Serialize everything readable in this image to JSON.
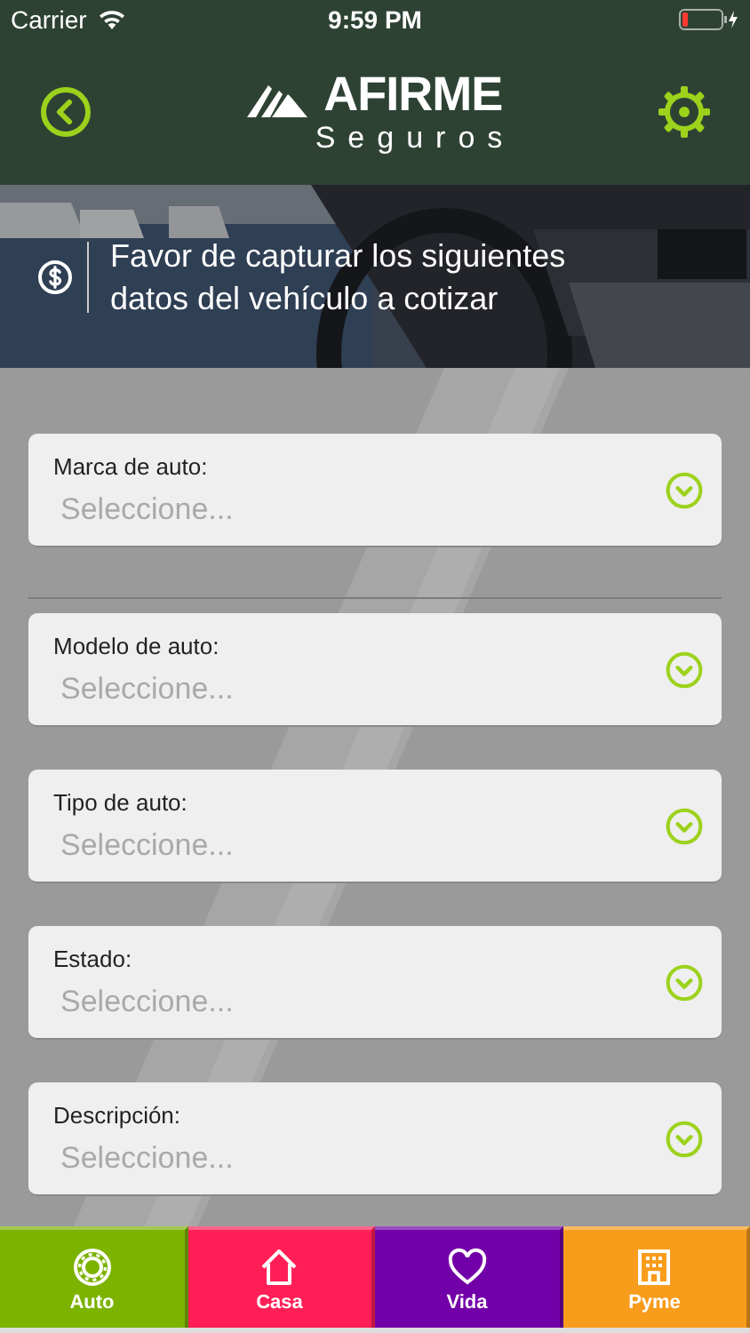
{
  "status_bar": {
    "carrier": "Carrier",
    "time": "9:59 PM"
  },
  "header": {
    "logo_name": "AFIRME",
    "logo_tagline": "Seguros"
  },
  "banner": {
    "kind": "picture",
    "message": "Favor de capturar los siguientes datos del vehículo a cotizar"
  },
  "fields": [
    {
      "label": "Marca de auto:",
      "placeholder": "Seleccione..."
    },
    {
      "label": "Modelo de auto:",
      "placeholder": "Seleccione..."
    },
    {
      "label": "Tipo de auto:",
      "placeholder": "Seleccione..."
    },
    {
      "label": "Estado:",
      "placeholder": "Seleccione..."
    },
    {
      "label": "Descripción:",
      "placeholder": "Seleccione..."
    }
  ],
  "tabs": [
    {
      "label": "Auto",
      "kind": "wheel",
      "color": "#7cb200"
    },
    {
      "label": "Casa",
      "kind": "house",
      "color": "#ff1f56"
    },
    {
      "label": "Vida",
      "kind": "heart",
      "color": "#7200a8"
    },
    {
      "label": "Pyme",
      "kind": "building",
      "color": "#f89c1c"
    }
  ]
}
